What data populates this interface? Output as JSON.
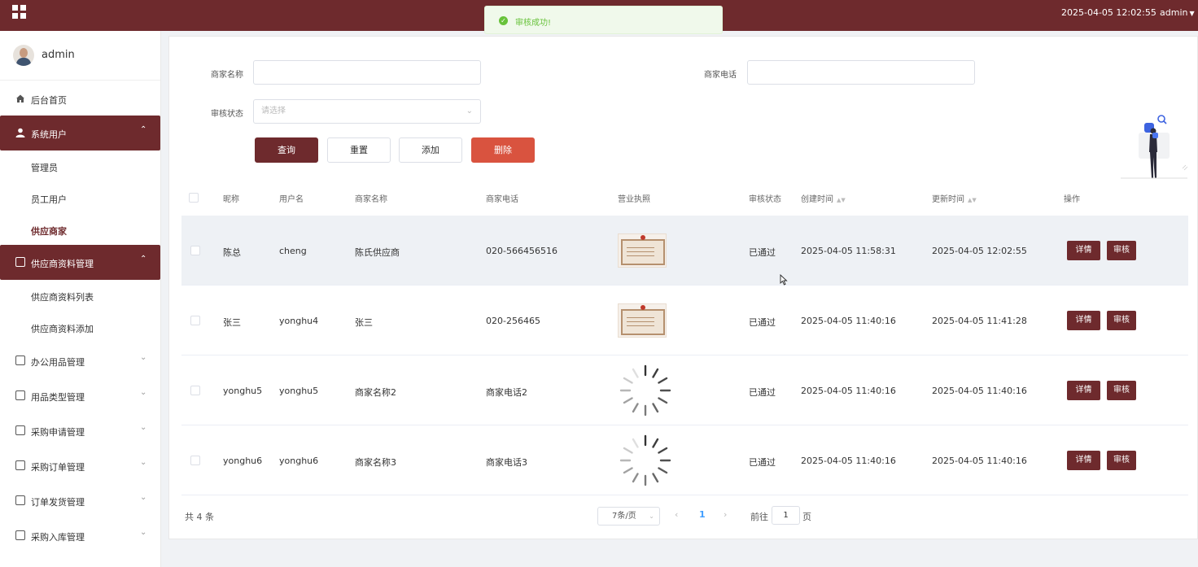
{
  "topbar": {
    "datetime": "2025-04-05 12:02:55",
    "user": "admin",
    "grid_icon": "grid-icon"
  },
  "toast": {
    "message": "审核成功!"
  },
  "sidebar": {
    "username": "admin",
    "items": [
      {
        "label": "后台首页",
        "icon": "home-icon"
      },
      {
        "label": "系统用户",
        "icon": "user-icon",
        "active": true
      },
      {
        "label": "管理员"
      },
      {
        "label": "员工用户"
      },
      {
        "label": "供应商家"
      },
      {
        "label": "供应商资料管理",
        "icon": "doc-icon",
        "active": true
      },
      {
        "label": "供应商资料列表"
      },
      {
        "label": "供应商资料添加"
      },
      {
        "label": "办公用品管理",
        "icon": "doc-icon"
      },
      {
        "label": "用品类型管理",
        "icon": "doc-icon"
      },
      {
        "label": "采购申请管理",
        "icon": "doc-icon"
      },
      {
        "label": "采购订单管理",
        "icon": "doc-icon"
      },
      {
        "label": "订单发货管理",
        "icon": "doc-icon"
      },
      {
        "label": "采购入库管理",
        "icon": "doc-icon"
      }
    ]
  },
  "search": {
    "merchant_name_label": "商家名称",
    "merchant_phone_label": "商家电话",
    "audit_status_label": "审核状态",
    "audit_status_placeholder": "请选择"
  },
  "buttons": {
    "query": "查询",
    "reset": "重置",
    "add": "添加",
    "delete": "删除"
  },
  "table": {
    "headers": [
      "昵称",
      "用户名",
      "商家名称",
      "商家电话",
      "营业执照",
      "审核状态",
      "创建时间",
      "更新时间",
      "操作"
    ],
    "rows": [
      {
        "nickname": "陈总",
        "username": "cheng",
        "merchant": "陈氏供应商",
        "phone": "020-566456516",
        "license": "image",
        "status": "已通过",
        "created": "2025-04-05 11:58:31",
        "updated": "2025-04-05 12:02:55",
        "detail": "详情",
        "audit": "审核"
      },
      {
        "nickname": "张三",
        "username": "yonghu4",
        "merchant": "张三",
        "phone": "020-256465",
        "license": "image",
        "status": "已通过",
        "created": "2025-04-05 11:40:16",
        "updated": "2025-04-05 11:41:28",
        "detail": "详情",
        "audit": "审核"
      },
      {
        "nickname": "yonghu5",
        "username": "yonghu5",
        "merchant": "商家名称2",
        "phone": "商家电话2",
        "license": "loading",
        "status": "已通过",
        "created": "2025-04-05 11:40:16",
        "updated": "2025-04-05 11:40:16",
        "detail": "详情",
        "audit": "审核"
      },
      {
        "nickname": "yonghu6",
        "username": "yonghu6",
        "merchant": "商家名称3",
        "phone": "商家电话3",
        "license": "loading",
        "status": "已通过",
        "created": "2025-04-05 11:40:16",
        "updated": "2025-04-05 11:40:16",
        "detail": "详情",
        "audit": "审核"
      }
    ]
  },
  "pagination": {
    "total": "共 4 条",
    "page_size": "7条/页",
    "current_page": "1",
    "goto_prefix": "前往",
    "goto_value": "1",
    "goto_suffix": "页"
  },
  "colors": {
    "brand": "#6e2a2d",
    "danger": "#d9533f",
    "success": "#67c23a",
    "link": "#409eff"
  }
}
